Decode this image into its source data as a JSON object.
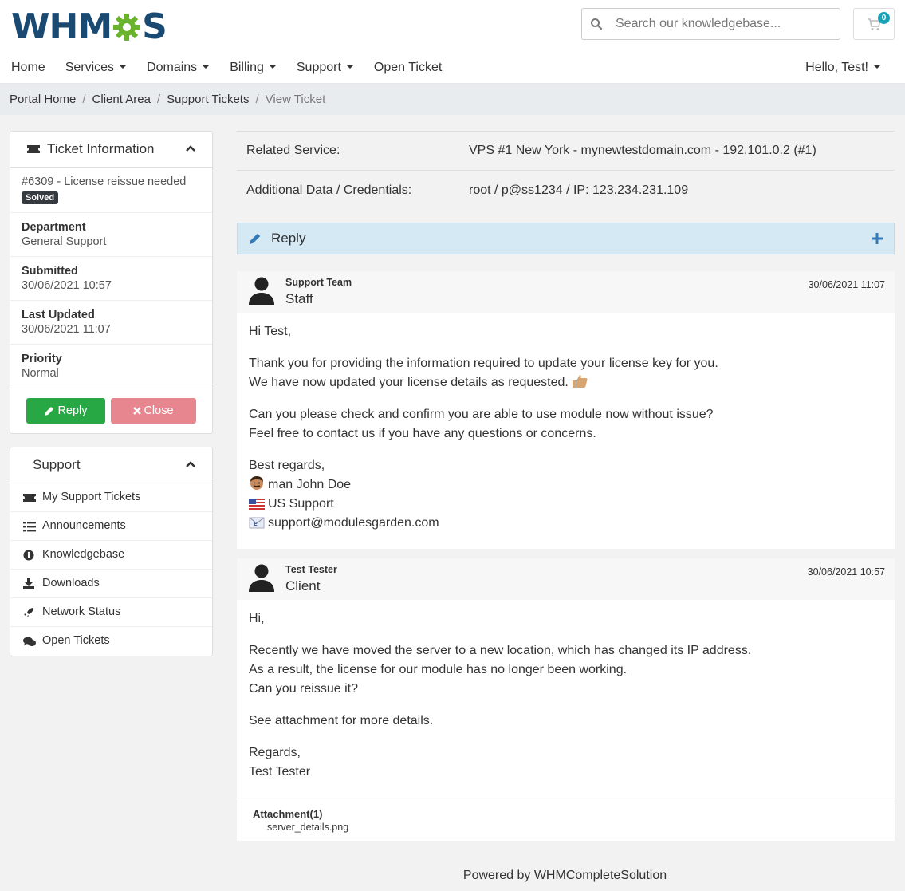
{
  "brand": {
    "logo_left": "WHM",
    "logo_right": "S",
    "gear_color": "#6ab42d",
    "text_color": "#1a4a72"
  },
  "search": {
    "placeholder": "Search our knowledgebase..."
  },
  "cart": {
    "count": "0"
  },
  "nav": {
    "items": [
      {
        "label": "Home",
        "dropdown": false
      },
      {
        "label": "Services",
        "dropdown": true
      },
      {
        "label": "Domains",
        "dropdown": true
      },
      {
        "label": "Billing",
        "dropdown": true
      },
      {
        "label": "Support",
        "dropdown": true
      },
      {
        "label": "Open Ticket",
        "dropdown": false
      }
    ],
    "user": "Hello, Test!"
  },
  "breadcrumb": [
    "Portal Home",
    "Client Area",
    "Support Tickets",
    "View Ticket"
  ],
  "ticket_info": {
    "title": "Ticket Information",
    "subject": "#6309 - License reissue needed",
    "status": "Solved",
    "fields": [
      {
        "label": "Department",
        "value": "General Support"
      },
      {
        "label": "Submitted",
        "value": "30/06/2021 10:57"
      },
      {
        "label": "Last Updated",
        "value": "30/06/2021 11:07"
      },
      {
        "label": "Priority",
        "value": "Normal"
      }
    ],
    "reply_label": "Reply",
    "close_label": "Close"
  },
  "support_panel": {
    "title": "Support",
    "items": [
      "My Support Tickets",
      "Announcements",
      "Knowledgebase",
      "Downloads",
      "Network Status",
      "Open Tickets"
    ]
  },
  "details": [
    {
      "label": "Related Service:",
      "value": "VPS #1 New York - mynewtestdomain.com - 192.101.0.2 (#1)"
    },
    {
      "label": "Additional Data / Credentials:",
      "value": "root / p@ss1234 / IP: 123.234.231.109"
    }
  ],
  "reply_bar": {
    "label": "Reply"
  },
  "messages": [
    {
      "name": "Support Team",
      "role": "Staff",
      "date": "30/06/2021 11:07",
      "greeting": "Hi Test,",
      "line1": "Thank you for providing the information required to update your license key for you.",
      "line2": "We have now updated your license details as requested.",
      "line3": "Can you please check and confirm you are able to use module now without issue?",
      "line4": "Feel free to contact us if you have any questions or concerns.",
      "signoff": "Best regards,",
      "sig1": "man John Doe",
      "sig2": "US Support",
      "sig3": "support@modulesgarden.com"
    },
    {
      "name": "Test Tester",
      "role": "Client",
      "date": "30/06/2021 10:57",
      "greeting": "Hi,",
      "line1": "Recently we have moved the server to a new location, which has changed its IP address.",
      "line2": "As a result, the license for our module has no longer been working.",
      "line3": "Can you reissue it?",
      "line4": "See attachment for more details.",
      "signoff": "Regards,",
      "sig1": "Test Tester",
      "attach_title": "Attachment(1)",
      "attach_file": "server_details.png"
    }
  ],
  "footer": "Powered by WHMCompleteSolution"
}
